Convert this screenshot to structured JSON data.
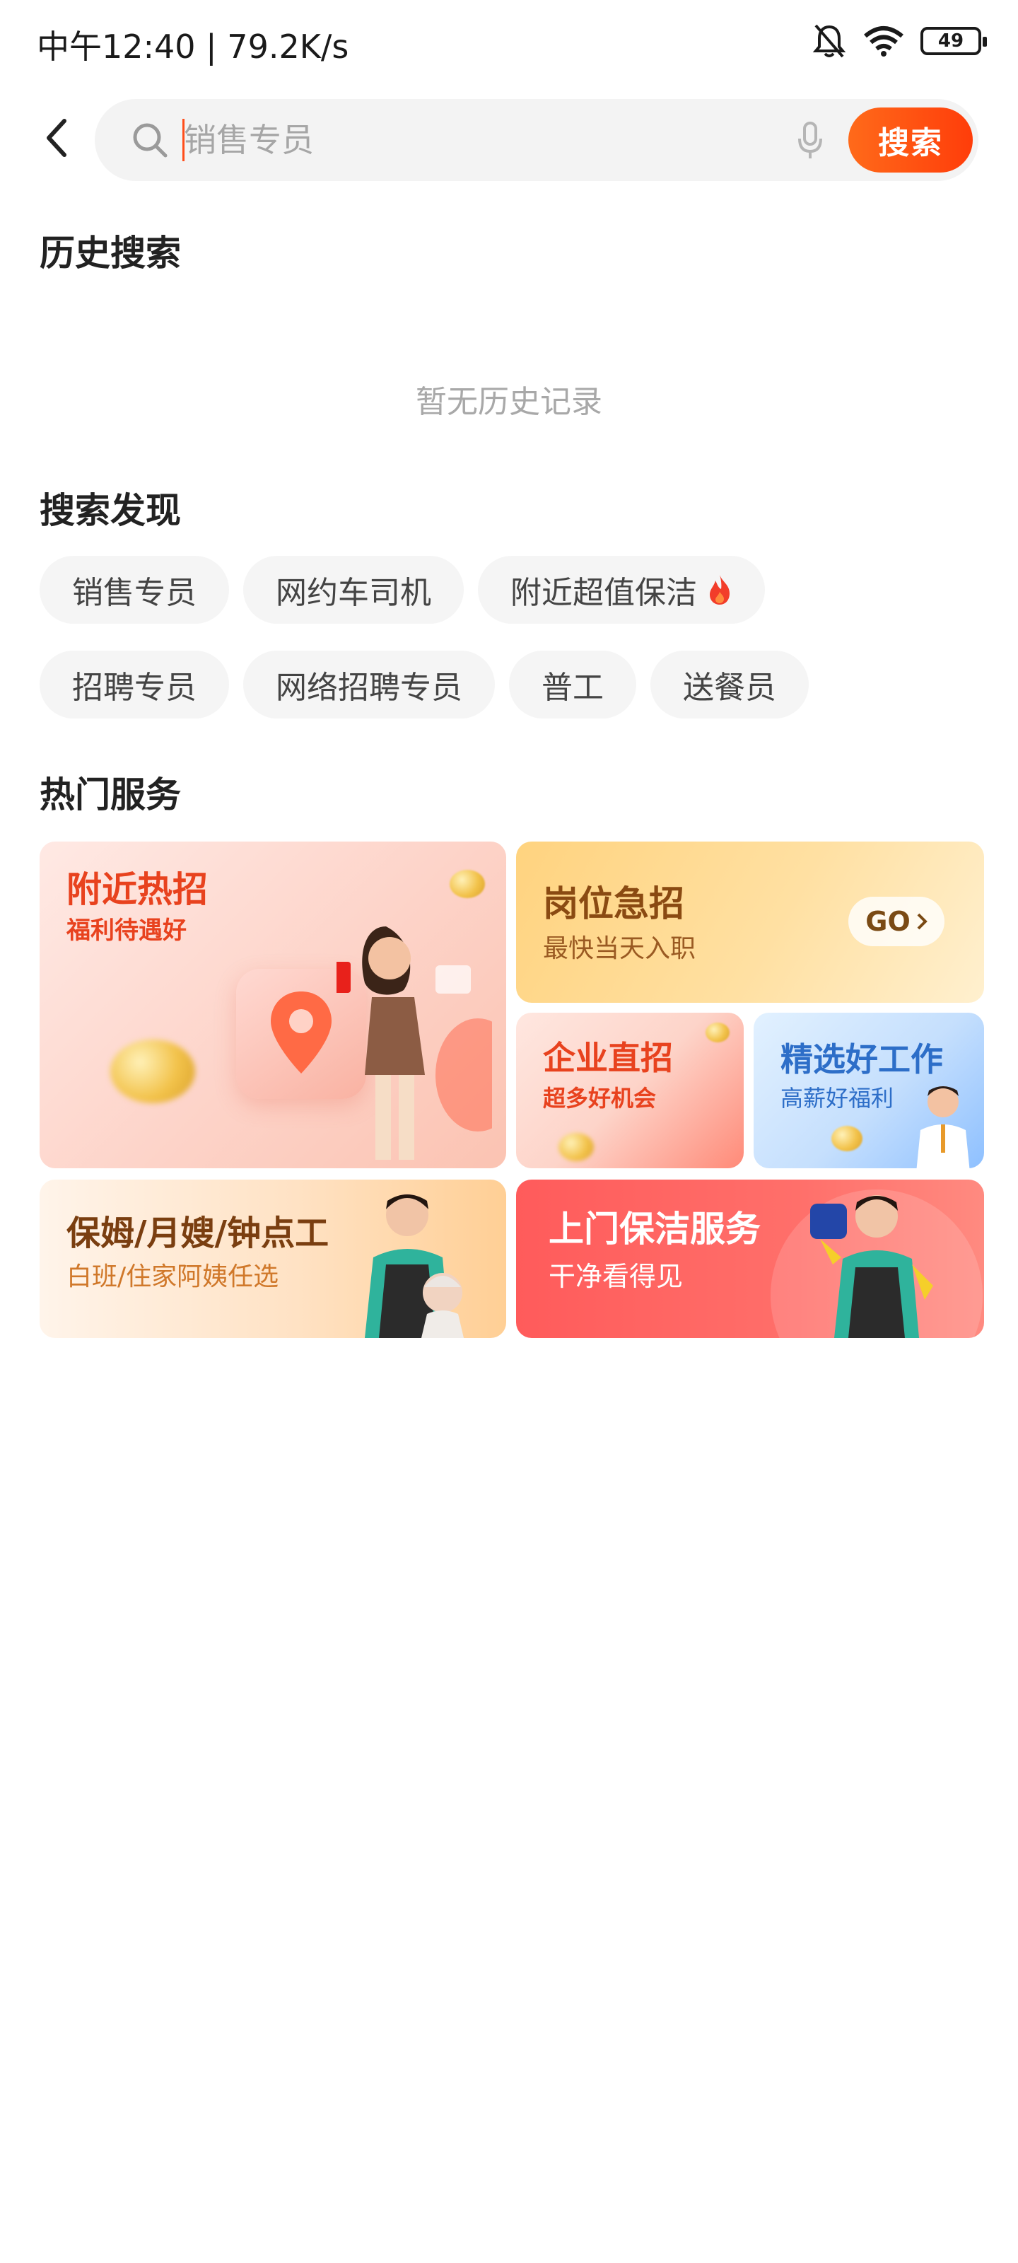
{
  "status_bar": {
    "time_speed": "中午12:40 | 79.2K/s",
    "battery": "49"
  },
  "search": {
    "placeholder": "销售专员",
    "button_label": "搜索"
  },
  "history": {
    "title": "历史搜索",
    "empty_text": "暂无历史记录"
  },
  "discover": {
    "title": "搜索发现",
    "row1": [
      "销售专员",
      "网约车司机",
      "附近超值保洁"
    ],
    "row2": [
      "招聘专员",
      "网络招聘专员",
      "普工",
      "送餐员"
    ]
  },
  "hot_services": {
    "title": "热门服务",
    "cards": {
      "nearby": {
        "title": "附近热招",
        "subtitle": "福利待遇好"
      },
      "urgent": {
        "title": "岗位急招",
        "subtitle": "最快当天入职",
        "go_label": "GO"
      },
      "direct": {
        "title": "企业直招",
        "subtitle": "超多好机会"
      },
      "selected": {
        "title": "精选好工作",
        "subtitle": "高薪好福利"
      },
      "nanny": {
        "title": "保姆/月嫂/钟点工",
        "subtitle": "白班/住家阿姨任选"
      },
      "cleaning": {
        "title": "上门保洁服务",
        "subtitle": "干净看得见"
      }
    }
  },
  "colors": {
    "accent": "#ff4d1a",
    "chip_bg": "#f5f5f5"
  }
}
